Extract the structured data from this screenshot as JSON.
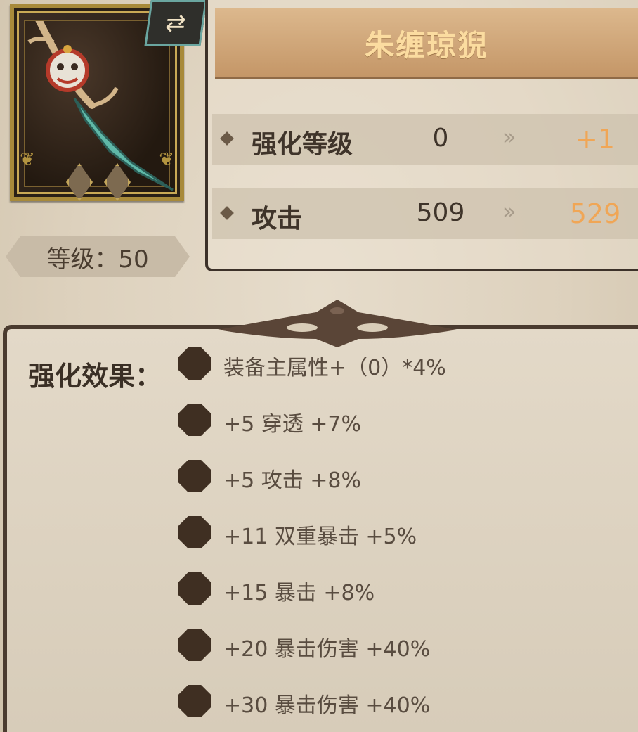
{
  "item": {
    "name": "朱缠琼猊",
    "level_text": "等级：50",
    "swap_icon": "swap-arrows-icon"
  },
  "stats": [
    {
      "label": "强化等级",
      "current": "0",
      "next": "+1",
      "arrow": "»"
    },
    {
      "label": "攻击",
      "current": "509",
      "next": "529",
      "arrow": "»"
    }
  ],
  "colors": {
    "title": "#fbdca0",
    "next_value": "#f0a656",
    "panel_border": "#3c3129"
  },
  "effects": {
    "label": "强化效果：",
    "items": [
      "装备主属性+（0）*4%",
      "+5  穿透 +7%",
      "+5  攻击 +8%",
      "+11  双重暴击 +5%",
      "+15  暴击 +8%",
      "+20  暴击伤害 +40%",
      "+30  暴击伤害 +40%"
    ]
  }
}
